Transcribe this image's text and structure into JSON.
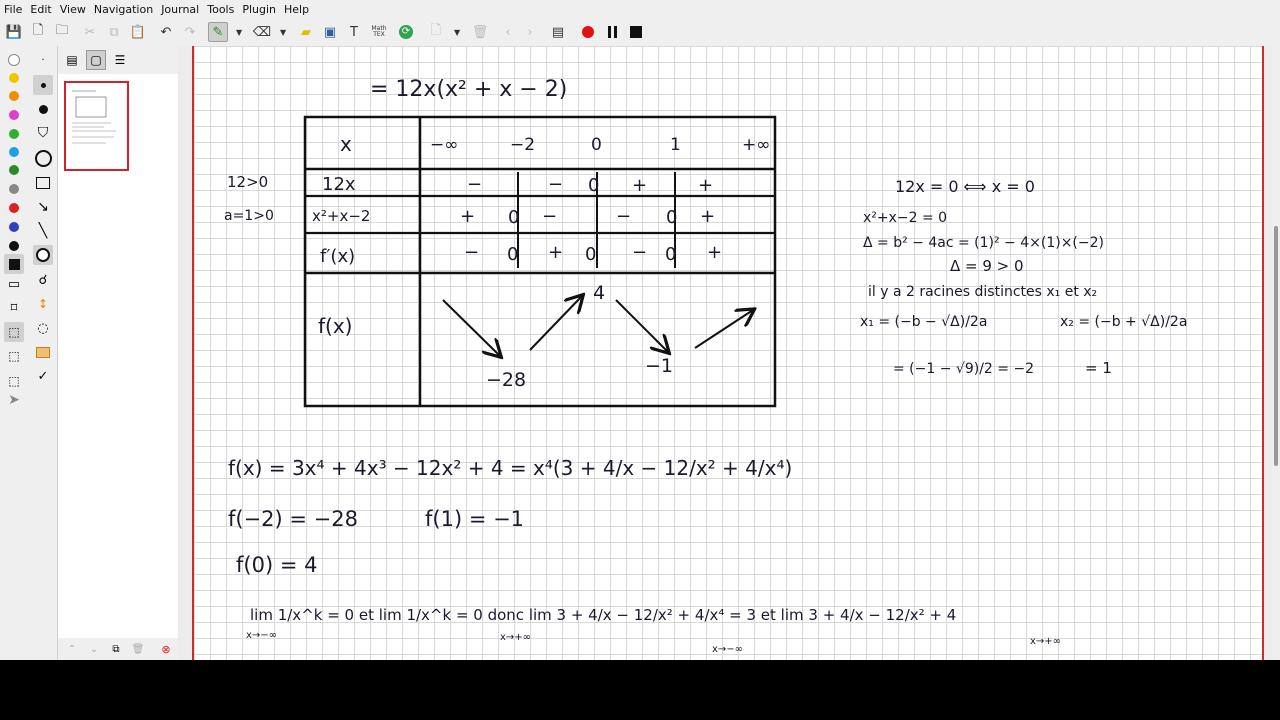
{
  "menu": [
    "File",
    "Edit",
    "View",
    "Navigation",
    "Journal",
    "Tools",
    "Plugin",
    "Help"
  ],
  "toolbar_icons": [
    "save-icon",
    "new-page-icon",
    "open-icon",
    "cut-icon",
    "copy-icon",
    "paste-icon",
    "undo-icon",
    "redo-icon",
    "pen-icon",
    "eraser-icon",
    "highlighter-icon",
    "image-icon",
    "text-icon",
    "latex-icon",
    "refresh-icon",
    "add-page-icon",
    "delete-page-icon",
    "back-icon",
    "forward-icon",
    "fullscreen-icon",
    "record-icon",
    "pause-icon",
    "stop-icon"
  ],
  "latex_label": "Math TEX",
  "colors": [
    "#ffffff",
    "#f2c500",
    "#f28c00",
    "#e040c8",
    "#30b030",
    "#20a0e0",
    "#2a8a2a",
    "#888888",
    "#e02020",
    "#3040c0",
    "#111111"
  ],
  "notes": {
    "line1": "= 12x(x² + x − 2)",
    "table_x_header": "x",
    "table_x_values": [
      "−∞",
      "−2",
      "0",
      "1",
      "+∞"
    ],
    "row_labels": [
      "12x",
      "x²+x−2",
      "f′(x)",
      "f(x)"
    ],
    "side_labels": [
      "12>0",
      "a=1>0"
    ],
    "row1_signs": [
      "−",
      "−",
      "0",
      "+",
      "+"
    ],
    "row2_signs": [
      "+",
      "0",
      "−",
      "−",
      "0",
      "+"
    ],
    "row3_signs": [
      "−",
      "0",
      "+",
      "0",
      "−",
      "0",
      "+"
    ],
    "variation_values": [
      "−28",
      "4",
      "−1"
    ],
    "right_lines": [
      "12x = 0 ⟺ x = 0",
      "x²+x−2 = 0",
      "Δ = b² − 4ac = (1)² − 4×(1)×(−2)",
      "Δ = 9 > 0",
      "il y a 2 racines distinctes x₁ et x₂",
      "x₁ = (−b − √Δ)/2a",
      "x₂ = (−b + √Δ)/2a",
      "= (−1 − √9)/2 = −2",
      "= 1"
    ],
    "bottom_lines": [
      "f(x) = 3x⁴ + 4x³ − 12x² + 4 = x⁴(3 + 4/x − 12/x² + 4/x⁴)",
      "f(−2) = −28",
      "f(1) = −1",
      "f(0) = 4",
      "lim 1/x^k = 0 et lim 1/x^k = 0 donc lim 3 + 4/x − 12/x² + 4/x⁴ = 3 et lim 3 + 4/x − 12/x² + 4"
    ],
    "lim_subs": [
      "x→−∞",
      "x→+∞",
      "x→−∞",
      "x→+∞"
    ]
  }
}
